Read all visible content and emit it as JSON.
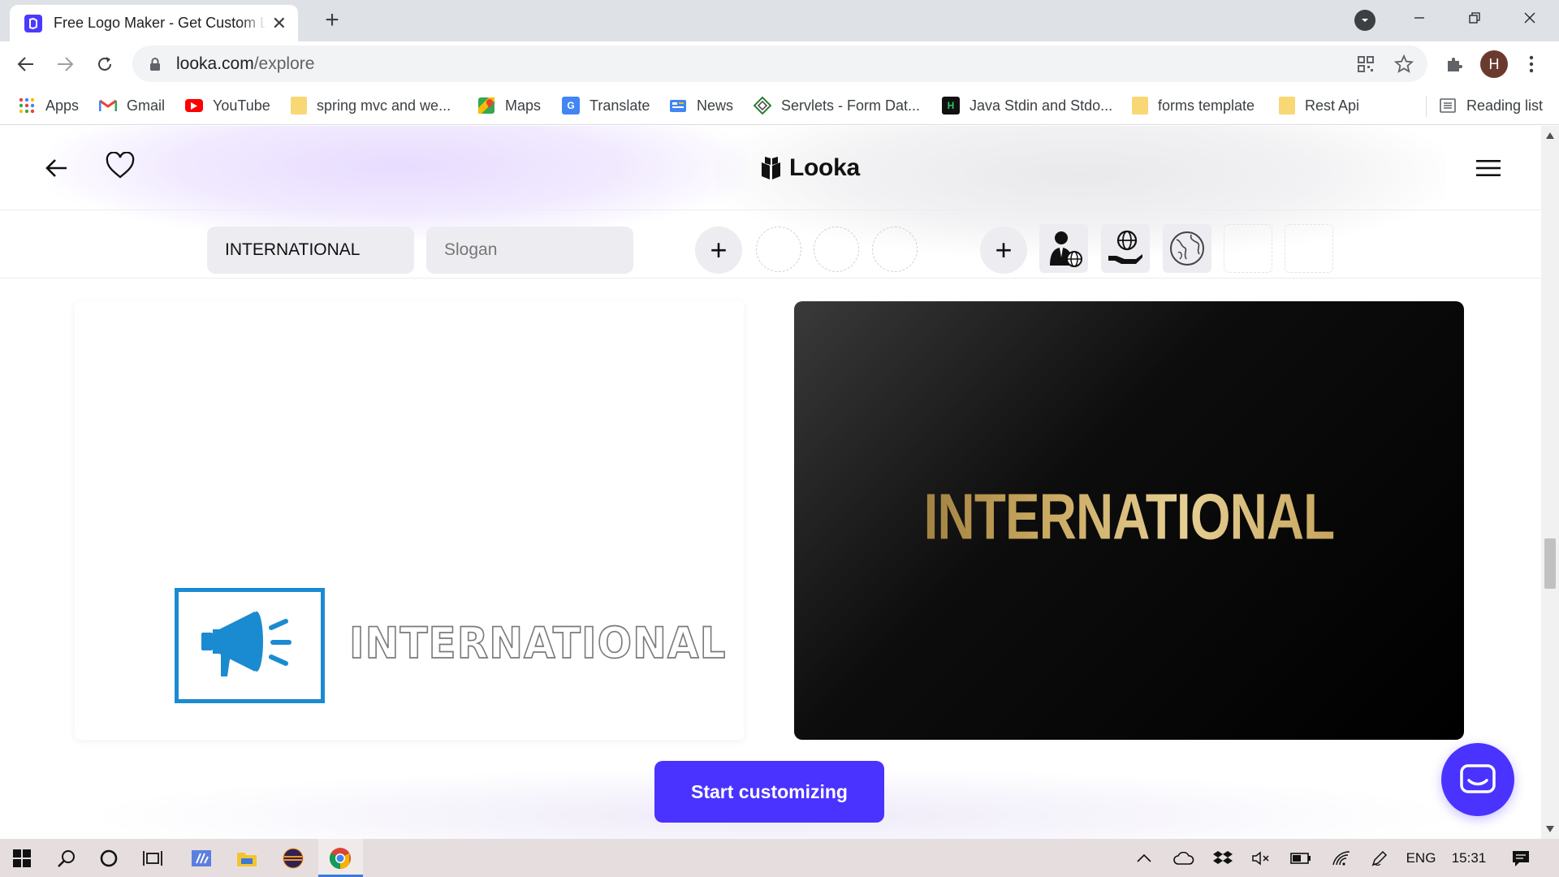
{
  "browser": {
    "tab": {
      "title": "Free Logo Maker - Get Custom Logo Designs"
    },
    "address": {
      "host": "looka.com",
      "path": "/explore"
    },
    "profile_initial": "H",
    "bookmarks": [
      {
        "label": "Apps",
        "icon": "apps-grid-icon"
      },
      {
        "label": "Gmail",
        "icon": "gmail-icon"
      },
      {
        "label": "YouTube",
        "icon": "youtube-icon"
      },
      {
        "label": "spring mvc and we...",
        "icon": "folder-icon"
      },
      {
        "label": "Maps",
        "icon": "maps-icon"
      },
      {
        "label": "Translate",
        "icon": "translate-icon"
      },
      {
        "label": "News",
        "icon": "news-icon"
      },
      {
        "label": "Servlets - Form Dat...",
        "icon": "servlets-icon"
      },
      {
        "label": "Java Stdin and Stdo...",
        "icon": "hackerrank-icon"
      },
      {
        "label": "forms template",
        "icon": "folder-icon"
      },
      {
        "label": "Rest Api",
        "icon": "folder-icon"
      }
    ],
    "reading_list": "Reading list"
  },
  "site": {
    "brand": "Looka",
    "company_name_value": "INTERNATIONAL",
    "slogan_placeholder": "Slogan",
    "logo_left_text": "INTERNATIONAL",
    "logo_right_text": "INTERNATIONAL",
    "cta_label": "Start customizing",
    "icon_tiles": [
      "businessman-globe-icon",
      "hand-globe-icon",
      "world-globe-icon"
    ],
    "colors": {
      "accent": "#4a33ff",
      "megaphone_blue": "#1b8bd1",
      "gold": "#c9a860"
    }
  },
  "taskbar": {
    "language": "ENG",
    "time": "15:31"
  }
}
